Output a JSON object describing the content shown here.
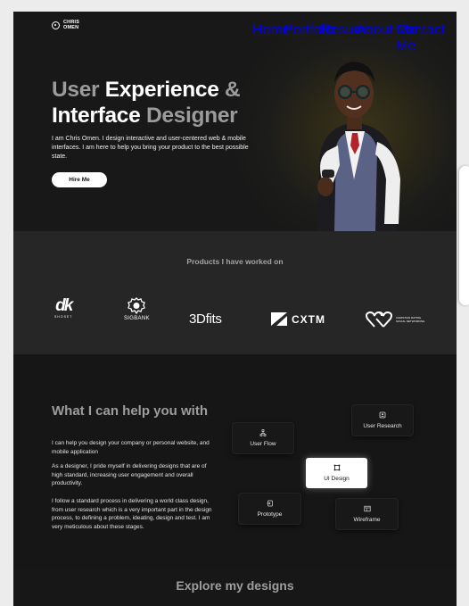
{
  "logo": {
    "line1": "CHRIS",
    "line2": "OMEN",
    "icon": "logo-circle-icon"
  },
  "nav": [
    "Home",
    "Portfolio",
    "Resume",
    "About Me",
    "Contact Me"
  ],
  "hero": {
    "title_part1": "User ",
    "title_part2": "Experience",
    "title_part3": " &",
    "title_part4": "Interface",
    "title_part5": " Designer",
    "description": "I am Chris Omen. I design interactive and user-centered web & mobile interfaces. I am here to help you bring your product to the best possible state.",
    "cta": "Hire Me"
  },
  "products": {
    "title": "Products I have worked on",
    "brands": [
      {
        "name": "dk",
        "sub": "SHOSET"
      },
      {
        "name": "SIGBANK"
      },
      {
        "name": "3Dfits"
      },
      {
        "name": "CXTM"
      },
      {
        "name": "CHRISTIAN DATING",
        "sub": "SOCIAL NETWORKING"
      }
    ]
  },
  "help": {
    "title": "What I can help you with",
    "p1": "I can help you design your company or personal website, and mobile application",
    "p2": "As a designer, I pride myself in delivering designs that are of high standard, increasing user engagement and overall productivity.",
    "p3": "I follow a standard process in delivering a world class design, from user research which is a very important part in the design process, to defining a problem, ideating, design and test. I am very meticulous about these stages.",
    "cards": {
      "user_research": "User Research",
      "user_flow": "User Flow",
      "ui_design": "UI Design",
      "prototype": "Prototype",
      "wireframe": "Wireframe"
    }
  },
  "explore": {
    "title": "Explore my designs"
  },
  "colors": {
    "background": "#171717",
    "muted_text": "#9b9b9b",
    "section": "#262626",
    "accent_glow": "#3a3417"
  }
}
